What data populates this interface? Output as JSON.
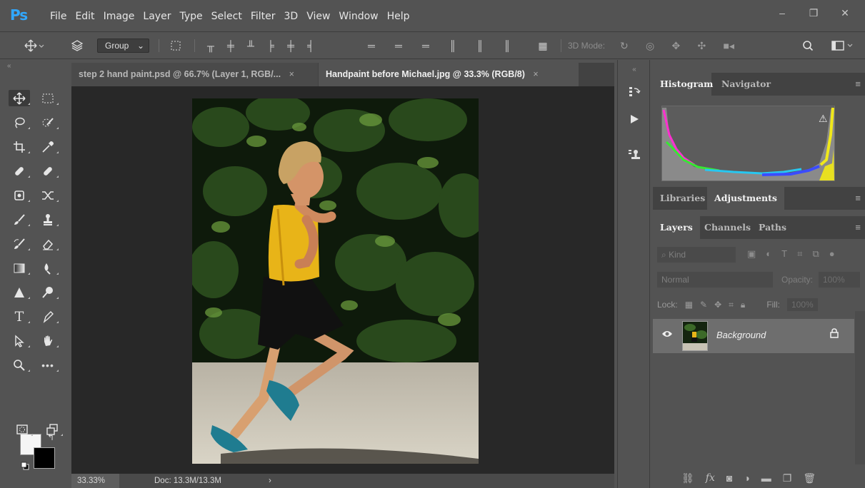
{
  "app": {
    "logo": "Ps",
    "menu": [
      "File",
      "Edit",
      "Image",
      "Layer",
      "Type",
      "Select",
      "Filter",
      "3D",
      "View",
      "Window",
      "Help"
    ],
    "window_controls": [
      "–",
      "❐",
      "✕"
    ]
  },
  "options_bar": {
    "auto_select": "Group",
    "three_d_mode_label": "3D Mode:"
  },
  "document": {
    "tabs": [
      {
        "label": "step 2 hand paint.psd @ 66.7% (Layer 1, RGB/...",
        "close": "×",
        "active": false
      },
      {
        "label": "Handpaint before Michael.jpg @ 33.3% (RGB/8)",
        "close": "×",
        "active": true
      }
    ],
    "status": {
      "zoom": "33.33%",
      "doc_size": "Doc: 13.3M/13.3M",
      "arrow": "›"
    }
  },
  "panels": {
    "top_tabs": [
      "Histogram",
      "Navigator"
    ],
    "mid_tabs": [
      "Libraries",
      "Adjustments"
    ],
    "layer_tabs": [
      "Layers",
      "Channels",
      "Paths"
    ],
    "filter_kind": "Kind",
    "blend_mode": "Normal",
    "opacity_label": "Opacity:",
    "opacity_value": "100%",
    "lock_label": "Lock:",
    "fill_label": "Fill:",
    "fill_value": "100%",
    "layers": [
      {
        "name": "Background",
        "visible": true,
        "locked": true
      }
    ]
  },
  "colors": {
    "ui_bg": "#535353",
    "canvas_bg": "#282828",
    "accent": "#31a8ff"
  }
}
